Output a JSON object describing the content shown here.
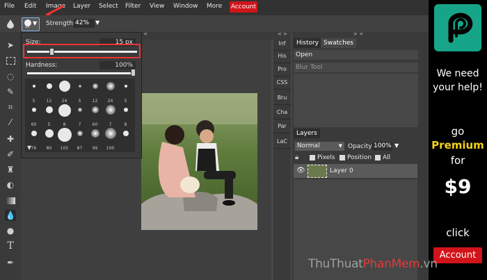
{
  "menubar": {
    "items": [
      "File",
      "Edit",
      "Image",
      "Layer",
      "Select",
      "Filter",
      "View",
      "Window",
      "More"
    ],
    "account_label": "Account"
  },
  "optionbar": {
    "brush_size_badge": "15",
    "strength_label": "Strength:",
    "strength_value": "42%"
  },
  "brush_popup": {
    "size_label": "Size:",
    "size_value": "15",
    "size_unit": "px",
    "hardness_label": "Hardness:",
    "hardness_value": "100%",
    "presets": [
      {
        "label": ""
      },
      {
        "label": ""
      },
      {
        "label": ""
      },
      {
        "label": ""
      },
      {
        "label": ""
      },
      {
        "label": ""
      },
      {
        "label": ""
      },
      {
        "label": "5"
      },
      {
        "label": "12"
      },
      {
        "label": "24"
      },
      {
        "label": "5"
      },
      {
        "label": "12"
      },
      {
        "label": "24"
      },
      {
        "label": "5"
      },
      {
        "label": ""
      },
      {
        "label": ""
      },
      {
        "label": ""
      },
      {
        "label": ""
      },
      {
        "label": ""
      },
      {
        "label": ""
      },
      {
        "label": ""
      },
      {
        "label": "60"
      },
      {
        "label": "5"
      },
      {
        "label": "8"
      },
      {
        "label": "7"
      },
      {
        "label": "60"
      },
      {
        "label": "7"
      },
      {
        "label": "8"
      },
      {
        "label": ""
      },
      {
        "label": ""
      },
      {
        "label": ""
      },
      {
        "label": ""
      },
      {
        "label": ""
      },
      {
        "label": ""
      },
      {
        "label": ""
      },
      {
        "label": "76"
      },
      {
        "label": "80"
      },
      {
        "label": "105"
      },
      {
        "label": "87"
      },
      {
        "label": "99"
      },
      {
        "label": "100"
      },
      {
        "label": ""
      }
    ]
  },
  "mini_panel": {
    "collapse_label": "< >",
    "tabs": [
      "Inf",
      "His",
      "Pro",
      "CSS",
      "Bru",
      "Cha",
      "Par",
      "LaC"
    ]
  },
  "history_panel": {
    "tabs": [
      "History",
      "Swatches"
    ],
    "items": [
      "Open",
      "Blur Tool"
    ]
  },
  "layers_panel": {
    "title": "Layers",
    "blend_mode": "Normal",
    "opacity_label": "Opacity:",
    "opacity_value": "100%",
    "lock_options": [
      "Pixels",
      "Position",
      "All"
    ],
    "layer_name": "Layer 0"
  },
  "ad": {
    "line1": "We need",
    "line2": "your help!",
    "go": "go",
    "premium": "Premium",
    "for": "for",
    "price": "$9",
    "click": "click",
    "account_button": "Account"
  },
  "watermark": {
    "part1": "ThuThuat",
    "part2": "PhanMem",
    "part3": ".vn"
  },
  "colors": {
    "accent_red": "#d1141a",
    "premium_yellow": "#f2d21b",
    "ad_teal": "#17a589"
  }
}
